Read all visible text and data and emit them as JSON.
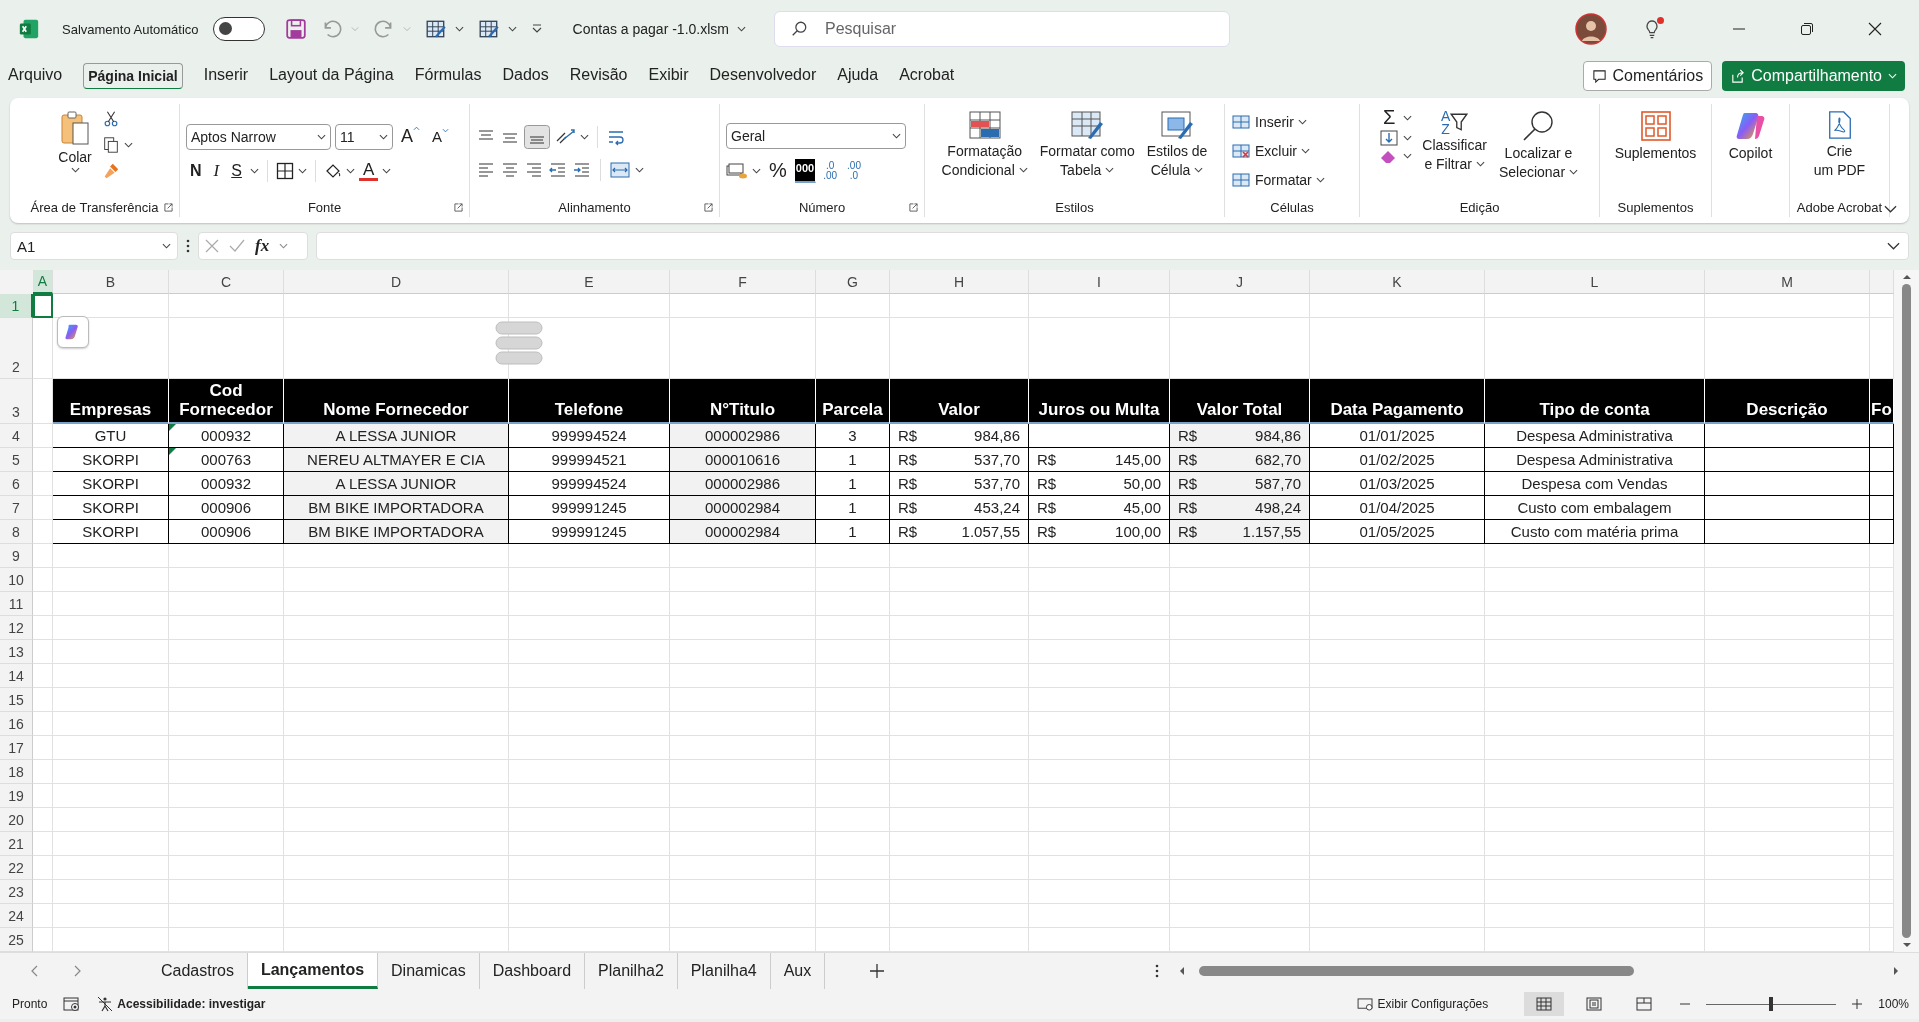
{
  "title_bar": {
    "autosave_label": "Salvamento Automático",
    "autosave_on": false,
    "filename": "Contas a pagar -1.0.xlsm",
    "search_placeholder": "Pesquisar",
    "notification": true
  },
  "menu": [
    {
      "label": "Arquivo",
      "selected": false
    },
    {
      "label": "Página Inicial",
      "selected": true
    },
    {
      "label": "Inserir",
      "selected": false
    },
    {
      "label": "Layout da Página",
      "selected": false
    },
    {
      "label": "Fórmulas",
      "selected": false
    },
    {
      "label": "Dados",
      "selected": false
    },
    {
      "label": "Revisão",
      "selected": false
    },
    {
      "label": "Exibir",
      "selected": false
    },
    {
      "label": "Desenvolvedor",
      "selected": false
    },
    {
      "label": "Ajuda",
      "selected": false
    },
    {
      "label": "Acrobat",
      "selected": false
    }
  ],
  "comments_button": "Comentários",
  "share_button": "Compartilhamento",
  "ribbon": {
    "clipboard": {
      "paste": "Colar",
      "label": "Área de Transferência"
    },
    "font": {
      "name": "Aptos Narrow",
      "size": "11",
      "grow": "A",
      "shrink": "A",
      "bold": "N",
      "italic": "I",
      "underline": "S",
      "color_letter": "A",
      "label": "Fonte"
    },
    "alignment": {
      "label": "Alinhamento"
    },
    "number": {
      "format": "Geral",
      "percent": "%",
      "thousands": "000",
      "increase": [
        ".0",
        ".00"
      ],
      "decrease": [
        ".00",
        ".0"
      ],
      "label": "Número"
    },
    "styles": {
      "buttons": [
        [
          "Formatação",
          "Condicional"
        ],
        [
          "Formatar como",
          "Tabela"
        ],
        [
          "Estilos de",
          "Célula"
        ]
      ],
      "label": "Estilos"
    },
    "cells": {
      "buttons": [
        "Inserir",
        "Excluir",
        "Formatar"
      ],
      "label": "Células"
    },
    "editing": {
      "sum": "Σ",
      "sort_letters": [
        "A",
        "Z"
      ],
      "sort": [
        "Classificar",
        "e Filtrar"
      ],
      "find": [
        "Localizar e",
        "Selecionar"
      ],
      "label": "Edição"
    },
    "addins": {
      "button": "Suplementos",
      "label": "Suplementos"
    },
    "copilot": {
      "button": "Copilot"
    },
    "acrobat": {
      "button": [
        "Crie",
        "um PDF"
      ],
      "label": "Adobe Acrobat"
    }
  },
  "formula_bar": {
    "name_box": "A1",
    "fx": "fx"
  },
  "column_headers": [
    {
      "label": "A",
      "selected": true
    },
    {
      "label": "B",
      "selected": false
    },
    {
      "label": "C",
      "selected": false
    },
    {
      "label": "D",
      "selected": false
    },
    {
      "label": "E",
      "selected": false
    },
    {
      "label": "F",
      "selected": false
    },
    {
      "label": "G",
      "selected": false
    },
    {
      "label": "H",
      "selected": false
    },
    {
      "label": "I",
      "selected": false
    },
    {
      "label": "J",
      "selected": false
    },
    {
      "label": "K",
      "selected": false
    },
    {
      "label": "L",
      "selected": false
    },
    {
      "label": "M",
      "selected": false
    }
  ],
  "row_numbers": [
    {
      "label": "1",
      "selected": true
    },
    {
      "label": "2",
      "selected": false
    },
    {
      "label": "3",
      "selected": false
    },
    {
      "label": "4",
      "selected": false
    },
    {
      "label": "5",
      "selected": false
    },
    {
      "label": "6",
      "selected": false
    },
    {
      "label": "7",
      "selected": false
    },
    {
      "label": "8",
      "selected": false
    },
    {
      "label": "9",
      "selected": false
    },
    {
      "label": "10",
      "selected": false
    },
    {
      "label": "11",
      "selected": false
    },
    {
      "label": "12",
      "selected": false
    },
    {
      "label": "13",
      "selected": false
    },
    {
      "label": "14",
      "selected": false
    },
    {
      "label": "15",
      "selected": false
    },
    {
      "label": "16",
      "selected": false
    },
    {
      "label": "17",
      "selected": false
    },
    {
      "label": "18",
      "selected": false
    },
    {
      "label": "19",
      "selected": false
    },
    {
      "label": "20",
      "selected": false
    },
    {
      "label": "21",
      "selected": false
    },
    {
      "label": "22",
      "selected": false
    },
    {
      "label": "23",
      "selected": false
    },
    {
      "label": "24",
      "selected": false
    },
    {
      "label": "25",
      "selected": false
    }
  ],
  "table": {
    "headers": [
      "Empresas",
      "Cod Fornecedor",
      "Nome Fornecedor",
      "Telefone",
      "N°Titulo",
      "Parcela",
      "Valor",
      "Juros ou Multa",
      "Valor Total",
      "Data Pagamento",
      "Tipo de conta",
      "Descrição",
      "Fo"
    ],
    "rows": [
      {
        "empresa": "GTU",
        "cod": "000932",
        "cod_flag": true,
        "fornecedor": "A LESSA JUNIOR",
        "telefone": "999994524",
        "titulo": "000002986",
        "parcela": "3",
        "valor": {
          "currency": "R$",
          "amount": "984,86"
        },
        "total": {
          "currency": "R$",
          "amount": "984,86"
        },
        "data": "01/01/2025",
        "tipo": "Despesa Administrativa"
      },
      {
        "empresa": "SKORPI",
        "cod": "000763",
        "cod_flag": true,
        "fornecedor": "NEREU ALTMAYER E CIA",
        "telefone": "999994521",
        "titulo": "000010616",
        "parcela": "1",
        "valor": {
          "currency": "R$",
          "amount": "537,70"
        },
        "juros": {
          "currency": "R$",
          "amount": "145,00"
        },
        "total": {
          "currency": "R$",
          "amount": "682,70"
        },
        "data": "01/02/2025",
        "tipo": "Despesa Administrativa"
      },
      {
        "empresa": "SKORPI",
        "cod": "000932",
        "cod_flag": false,
        "fornecedor": "A LESSA JUNIOR",
        "telefone": "999994524",
        "titulo": "000002986",
        "parcela": "1",
        "valor": {
          "currency": "R$",
          "amount": "537,70"
        },
        "juros": {
          "currency": "R$",
          "amount": "50,00"
        },
        "total": {
          "currency": "R$",
          "amount": "587,70"
        },
        "data": "01/03/2025",
        "tipo": "Despesa com Vendas"
      },
      {
        "empresa": "SKORPI",
        "cod": "000906",
        "cod_flag": false,
        "fornecedor": "BM BIKE IMPORTADORA",
        "telefone": "999991245",
        "titulo": "000002984",
        "parcela": "1",
        "valor": {
          "currency": "R$",
          "amount": "453,24"
        },
        "juros": {
          "currency": "R$",
          "amount": "45,00"
        },
        "total": {
          "currency": "R$",
          "amount": "498,24"
        },
        "data": "01/04/2025",
        "tipo": "Custo com embalagem"
      },
      {
        "empresa": "SKORPI",
        "cod": "000906",
        "cod_flag": false,
        "fornecedor": "BM BIKE IMPORTADORA",
        "telefone": "999991245",
        "titulo": "000002984",
        "parcela": "1",
        "valor": {
          "currency": "R$",
          "amount": "1.057,55"
        },
        "juros": {
          "currency": "R$",
          "amount": "100,00"
        },
        "total": {
          "currency": "R$",
          "amount": "1.157,55"
        },
        "data": "01/05/2025",
        "tipo": "Custo com matéria prima"
      }
    ]
  },
  "sheet_tabs": [
    {
      "label": "Cadastros",
      "selected": false
    },
    {
      "label": "Lançamentos",
      "selected": true
    },
    {
      "label": "Dinamicas",
      "selected": false
    },
    {
      "label": "Dashboard",
      "selected": false
    },
    {
      "label": "Planilha2",
      "selected": false
    },
    {
      "label": "Planilha4",
      "selected": false
    },
    {
      "label": "Aux",
      "selected": false
    }
  ],
  "status_bar": {
    "ready": "Pronto",
    "accessibility": "Acessibilidade: investigar",
    "display_settings": "Exibir Configurações",
    "views": [
      {
        "kind": "normal",
        "selected": true
      },
      {
        "kind": "page_layout",
        "selected": false
      },
      {
        "kind": "page_break",
        "selected": false
      }
    ],
    "zoom": {
      "level": 0.5
    },
    "zoom_text": "100%"
  }
}
